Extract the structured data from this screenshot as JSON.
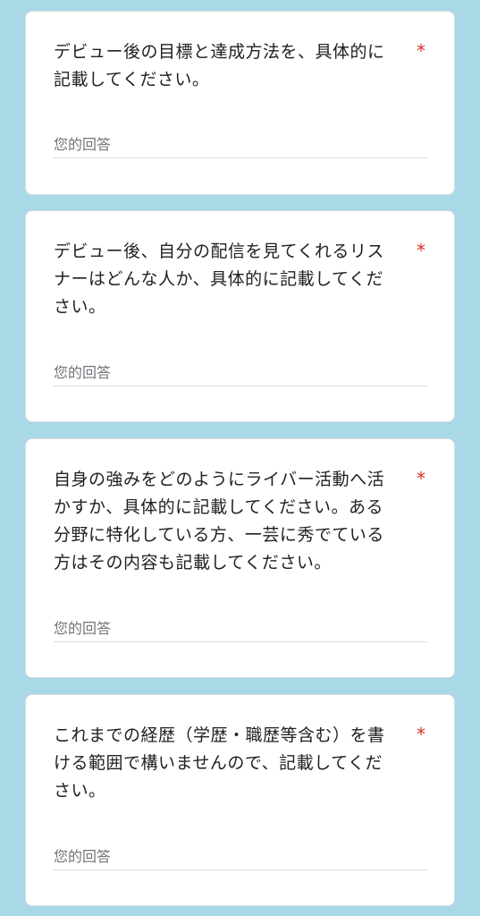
{
  "questions": [
    {
      "text": "デビュー後の目標と達成方法を、具体的に記載してください。",
      "required_mark": "*",
      "placeholder": "您的回答"
    },
    {
      "text": "デビュー後、自分の配信を見てくれるリスナーはどんな人か、具体的に記載してください。",
      "required_mark": "*",
      "placeholder": "您的回答"
    },
    {
      "text": "自身の強みをどのようにライバー活動へ活かすか、具体的に記載してください。ある分野に特化している方、一芸に秀でている方はその内容も記載してください。",
      "required_mark": "*",
      "placeholder": "您的回答"
    },
    {
      "text": "これまでの経歴（学歴・職歴等含む）を書ける範囲で構いませんので、記載してください。",
      "required_mark": "*",
      "placeholder": "您的回答"
    }
  ],
  "colors": {
    "background": "#a9d8e7",
    "card": "#ffffff",
    "required": "#d93025",
    "placeholder": "#70757a",
    "underline": "#dadce0"
  }
}
